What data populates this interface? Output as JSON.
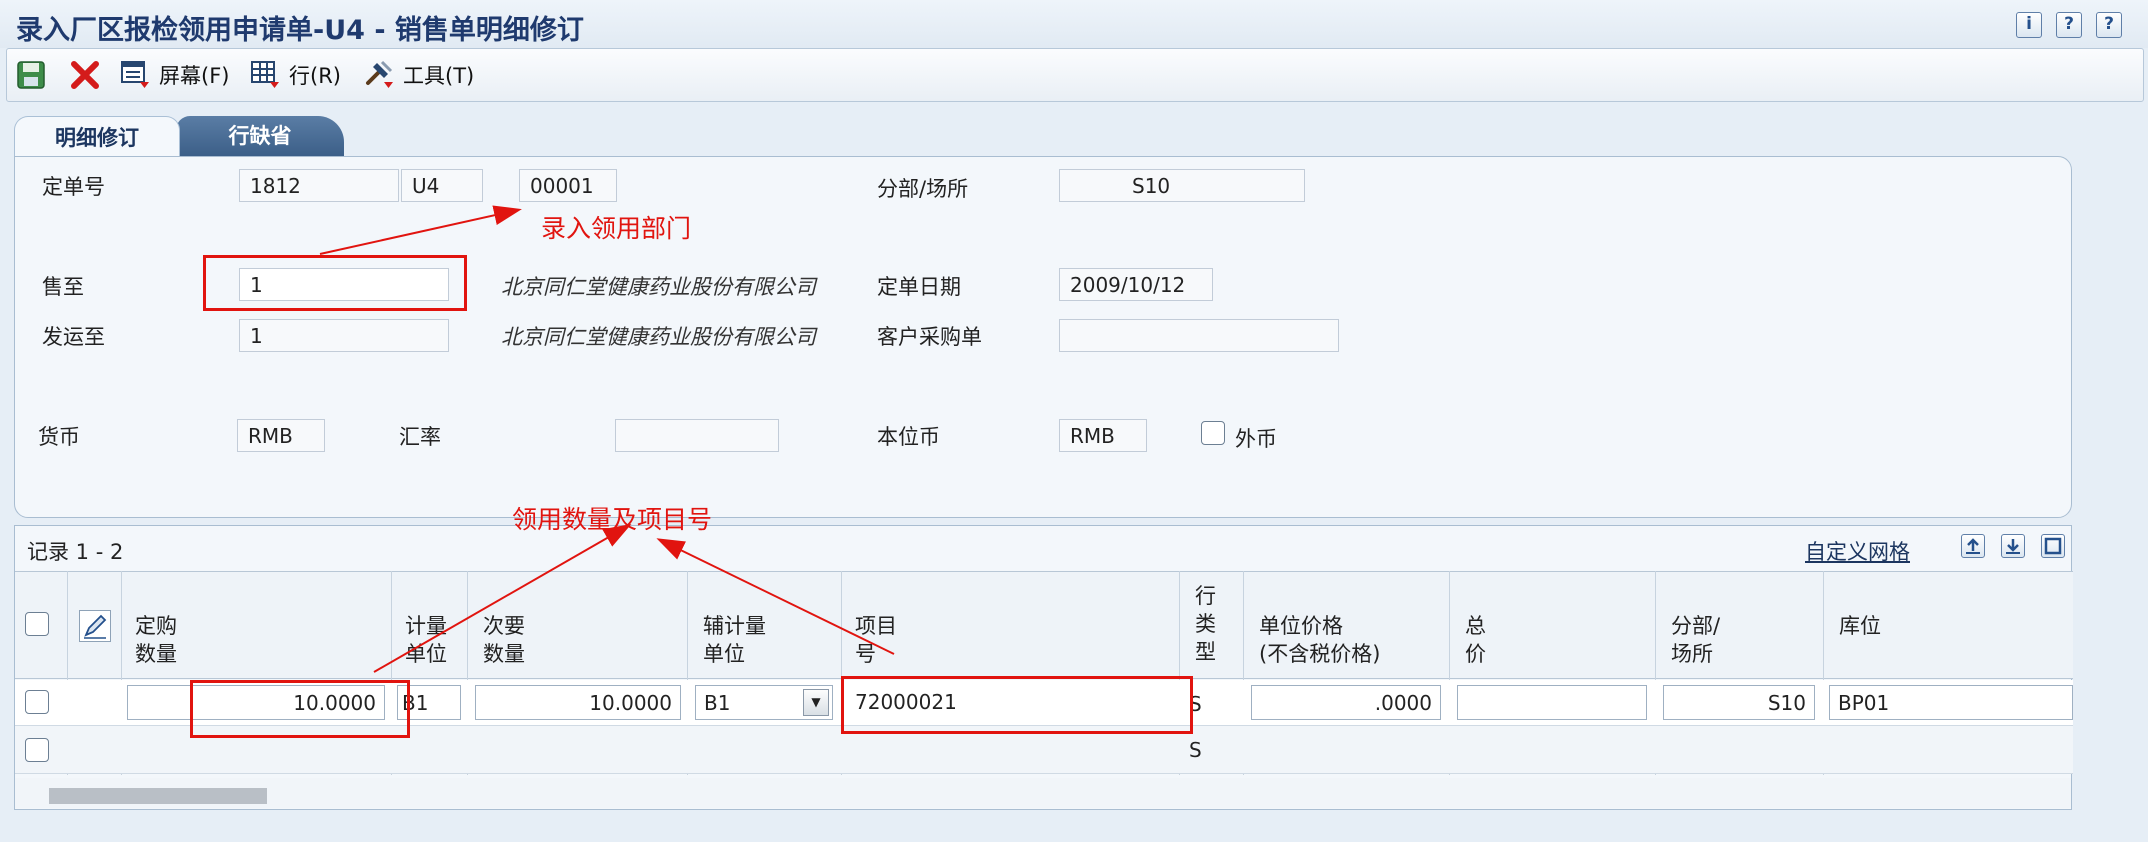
{
  "window": {
    "title": "录入厂区报检领用申请单-U4 - 销售单明细修订",
    "help_icons": [
      "i",
      "?",
      "?"
    ]
  },
  "toolbar": {
    "screen_label": "屏幕(F)",
    "row_label": "行(R)",
    "tools_label": "工具(T)"
  },
  "tabs": [
    {
      "label": "明细修订",
      "active": true
    },
    {
      "label": "行缺省",
      "active": false
    }
  ],
  "form": {
    "order_no": {
      "label": "定单号",
      "number": "1812",
      "type": "U4",
      "company": "00001"
    },
    "branch": {
      "label": "分部/场所",
      "value": "S10"
    },
    "sold_to": {
      "label": "售至",
      "value": "1",
      "name": "北京同仁堂健康药业股份有限公司"
    },
    "order_date": {
      "label": "定单日期",
      "value": "2009/10/12"
    },
    "ship_to": {
      "label": "发运至",
      "value": "1",
      "name": "北京同仁堂健康药业股份有限公司"
    },
    "customer_po": {
      "label": "客户采购单",
      "value": ""
    },
    "currency": {
      "label": "货币",
      "value": "RMB"
    },
    "exchange_rate": {
      "label": "汇率",
      "value": ""
    },
    "base_currency": {
      "label": "本位币",
      "value": "RMB"
    },
    "foreign_currency": {
      "label": "外币",
      "checked": false
    }
  },
  "annotations": {
    "dept_note": "录入领用部门",
    "qty_note": "领用数量及项目号"
  },
  "grid": {
    "record_count": "记录 1 - 2",
    "customize_link": "自定义网格",
    "columns": [
      {
        "line1": "定购",
        "line2": "数量"
      },
      {
        "line1": "计量",
        "line2": "单位"
      },
      {
        "line1": "次要",
        "line2": "数量"
      },
      {
        "line1": "辅计量",
        "line2": "单位"
      },
      {
        "line1": "项目",
        "line2": "号"
      },
      {
        "line1": "行",
        "line2": "类",
        "line3": "型"
      },
      {
        "line1": "单位价格",
        "line2": "(不含税价格)"
      },
      {
        "line1": "总",
        "line2": "价"
      },
      {
        "line1": "分部/",
        "line2": "场所"
      },
      {
        "line1": "",
        "line2": "库位"
      }
    ],
    "rows": [
      {
        "qty": "10.0000",
        "uom": "B1",
        "sec_qty": "10.0000",
        "sec_uom": "B1",
        "item": "72000021",
        "line_type": "S",
        "unit_price": ".0000",
        "total": "",
        "branch": "S10",
        "location": "BP01"
      },
      {
        "qty": "",
        "uom": "",
        "sec_qty": "",
        "sec_uom": "",
        "item": "",
        "line_type": "S",
        "unit_price": "",
        "total": "",
        "branch": "",
        "location": ""
      }
    ]
  }
}
